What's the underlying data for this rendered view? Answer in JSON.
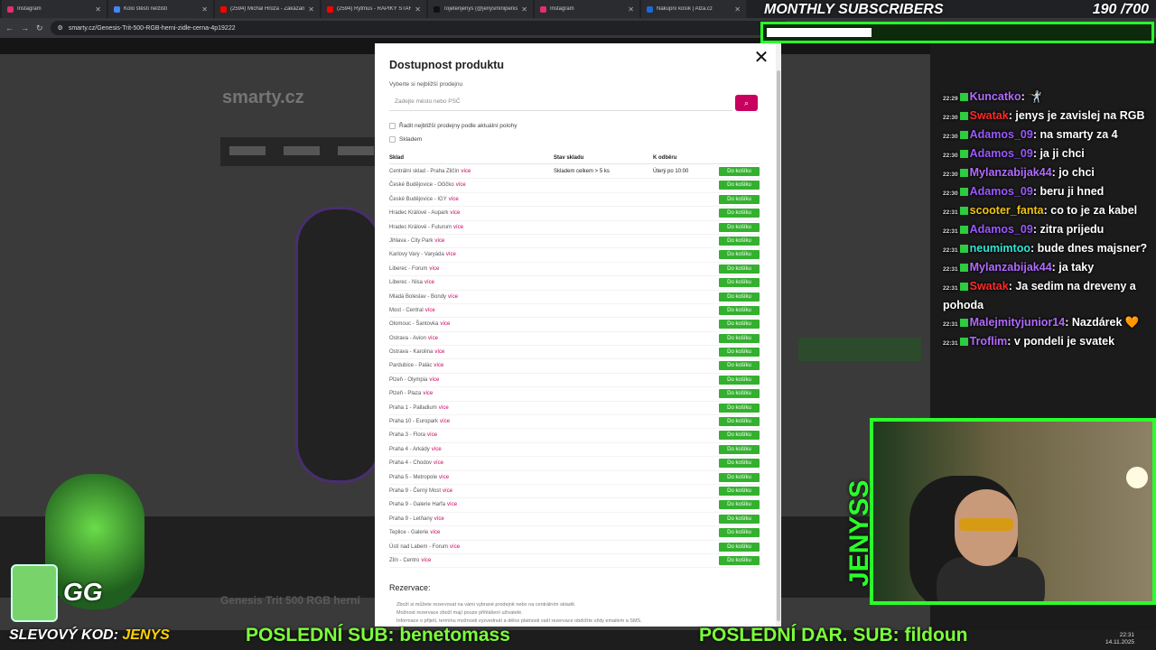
{
  "browser": {
    "tabs": [
      {
        "title": "Instagram",
        "color": "#e1306c"
      },
      {
        "title": "Kolo štěstí nelžiští",
        "color": "#4285f4"
      },
      {
        "title": "(2594) Michal Hrůza - Zakázané",
        "color": "#ff0000"
      },
      {
        "title": "(2594) Rytmus - RAPÍKY STARÉ...",
        "color": "#ff0000"
      },
      {
        "title": "Tojetenjenys (@jenysminipenis)",
        "color": "#111111"
      },
      {
        "title": "Instagram",
        "color": "#e1306c"
      },
      {
        "title": "Nákupní košík | Alza.cz",
        "color": "#1c6ad6"
      }
    ],
    "url": "smarty.cz/Genesis-Trit-500-RGB-herni-zidle-cerna-4p19222"
  },
  "page": {
    "logo": "smarty.cz",
    "product_title": "Genesis Trit 500 RGB herní"
  },
  "modal": {
    "title": "Dostupnost produktu",
    "subtitle": "Vyberte si nejbližší prodejnu",
    "search_placeholder": "Zadejte město nebo PSČ",
    "sort_label": "Řadit nejbližší prodejny podle aktuální polohy",
    "stock_label": "Skladem",
    "col_store": "Sklad",
    "col_stock": "Stav skladu",
    "col_pickup": "K odběru",
    "more_label": "více",
    "cart_label": "Do košíku",
    "rows": [
      {
        "name": "Centrální sklad - Praha Zličín",
        "stock": "Skladem celkem > 5 ks",
        "pickup": "Úterý po 10:00"
      },
      {
        "name": "České Budějovice - Očičko",
        "stock": "",
        "pickup": ""
      },
      {
        "name": "České Budějovice - IGY",
        "stock": "",
        "pickup": ""
      },
      {
        "name": "Hradec Králové - Aupark",
        "stock": "",
        "pickup": ""
      },
      {
        "name": "Hradec Králové - Futurum",
        "stock": "",
        "pickup": ""
      },
      {
        "name": "Jihlava - City Park",
        "stock": "",
        "pickup": ""
      },
      {
        "name": "Karlovy Vary - Varyáda",
        "stock": "",
        "pickup": ""
      },
      {
        "name": "Liberec - Forum",
        "stock": "",
        "pickup": ""
      },
      {
        "name": "Liberec - Nisa",
        "stock": "",
        "pickup": ""
      },
      {
        "name": "Mladá Boleslav - Bondy",
        "stock": "",
        "pickup": ""
      },
      {
        "name": "Most - Central",
        "stock": "",
        "pickup": ""
      },
      {
        "name": "Olomouc - Šantovka",
        "stock": "",
        "pickup": ""
      },
      {
        "name": "Ostrava - Avion",
        "stock": "",
        "pickup": ""
      },
      {
        "name": "Ostrava - Karolina",
        "stock": "",
        "pickup": ""
      },
      {
        "name": "Pardubice - Palác",
        "stock": "",
        "pickup": ""
      },
      {
        "name": "Plzeň - Olympia",
        "stock": "",
        "pickup": ""
      },
      {
        "name": "Plzeň - Plaza",
        "stock": "",
        "pickup": ""
      },
      {
        "name": "Praha 1 - Palladium",
        "stock": "",
        "pickup": ""
      },
      {
        "name": "Praha 10 - Europark",
        "stock": "",
        "pickup": ""
      },
      {
        "name": "Praha 3 - Flora",
        "stock": "",
        "pickup": ""
      },
      {
        "name": "Praha 4 - Arkády",
        "stock": "",
        "pickup": ""
      },
      {
        "name": "Praha 4 - Chodov",
        "stock": "",
        "pickup": ""
      },
      {
        "name": "Praha 5 - Metropole",
        "stock": "",
        "pickup": ""
      },
      {
        "name": "Praha 9 - Černý Most",
        "stock": "",
        "pickup": ""
      },
      {
        "name": "Praha 9 - Galerie Harfa",
        "stock": "",
        "pickup": ""
      },
      {
        "name": "Praha 9 - Letňany",
        "stock": "",
        "pickup": ""
      },
      {
        "name": "Teplice - Galerie",
        "stock": "",
        "pickup": ""
      },
      {
        "name": "Ústí nad Labem - Forum",
        "stock": "",
        "pickup": ""
      },
      {
        "name": "Zlín - Centro",
        "stock": "",
        "pickup": ""
      }
    ],
    "reservation_title": "Rezervace:",
    "notes": [
      "Zboží si můžete rezervovat na vámi vybrané prodejně nebo na centrálním skladě.",
      "Možnost rezervace zboží mají pouze přihlášení uživatelé.",
      "Informace o přijetí, termínu možnosti vyzvednutí a délce platnosti vaší rezervace obdržíte vždy emailem a SMS."
    ]
  },
  "chat": [
    {
      "time": "22:29",
      "user": "Kuncatko",
      "color": "#b36bff",
      "text": ": 🤺"
    },
    {
      "time": "22:30",
      "user": "Swatak",
      "color": "#ff2a2a",
      "text": ": jenys je zavislej na RGB"
    },
    {
      "time": "22:30",
      "user": "Adamos_09",
      "color": "#9b59ff",
      "text": ": na smarty za 4"
    },
    {
      "time": "22:30",
      "user": "Adamos_09",
      "color": "#9b59ff",
      "text": ": ja ji chci"
    },
    {
      "time": "22:30",
      "user": "Mylanzabijak44",
      "color": "#b36bff",
      "text": ": jo chci"
    },
    {
      "time": "22:30",
      "user": "Adamos_09",
      "color": "#9b59ff",
      "text": ": beru ji hned"
    },
    {
      "time": "22:31",
      "user": "scooter_fanta",
      "color": "#f1c40f",
      "text": ": co to je za kabel"
    },
    {
      "time": "22:31",
      "user": "Adamos_09",
      "color": "#9b59ff",
      "text": ": zitra prijedu"
    },
    {
      "time": "22:31",
      "user": "neumimtoo",
      "color": "#2ee6d6",
      "text": ": bude dnes majsner?"
    },
    {
      "time": "22:31",
      "user": "Mylanzabijak44",
      "color": "#b36bff",
      "text": ": ja taky"
    },
    {
      "time": "22:31",
      "user": "Swatak",
      "color": "#ff2a2a",
      "text": ": Ja sedim na dreveny a pohoda"
    },
    {
      "time": "22:31",
      "user": "Malejmityjunior14",
      "color": "#b36bff",
      "text": ": Nazdárek 🧡"
    },
    {
      "time": "22:31",
      "user": "Troflim",
      "color": "#b36bff",
      "text": ": v pondeli je svatek"
    }
  ],
  "overlay": {
    "subs_label": "MONTHLY SUBSCRIBERS",
    "subs_count": "190  /700",
    "subs_progress": 0.27,
    "webcam_logo": "JENYSS",
    "promo_prefix": "SLEVOVÝ KOD:",
    "promo_code": "JENYS",
    "last_sub": "POSLEDNÍ SUB: benetomass",
    "last_gift": "POSLEDNÍ DAR. SUB: fildoun",
    "art_text": "GG"
  },
  "taskbar": {
    "time": "22:31",
    "date": "14.11.2025"
  }
}
